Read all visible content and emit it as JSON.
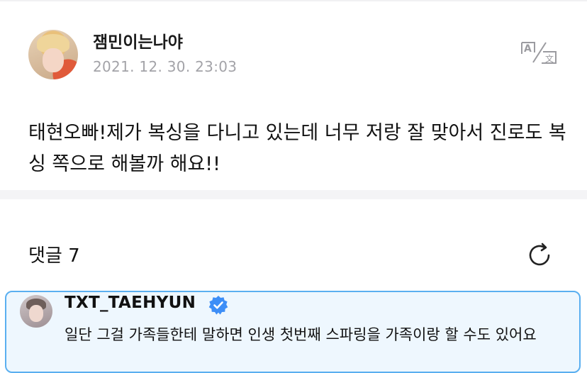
{
  "post": {
    "username": "잼민이는나야",
    "timestamp": "2021. 12. 30. 23:03",
    "text": "태현오빠!제가 복싱을 다니고 있는데 너무 저랑 잘 맞아서 진로도 복싱 쪽으로 해볼까 해요!!"
  },
  "comments": {
    "label": "댓글 7"
  },
  "comment": {
    "author": "TXT_TAEHYUN",
    "text": "일단 그걸 가족들한테 말하면 인생 첫번째 스파링을 가족이랑 할 수도 있어요"
  },
  "icons": {
    "translate": "translate-icon",
    "refresh": "refresh-icon",
    "verified": "verified-badge-icon"
  },
  "colors": {
    "accent": "#5aaff0",
    "comment_bg": "#eef7fe",
    "timestamp": "#a3a3a8",
    "verified": "#3d8ef7"
  }
}
